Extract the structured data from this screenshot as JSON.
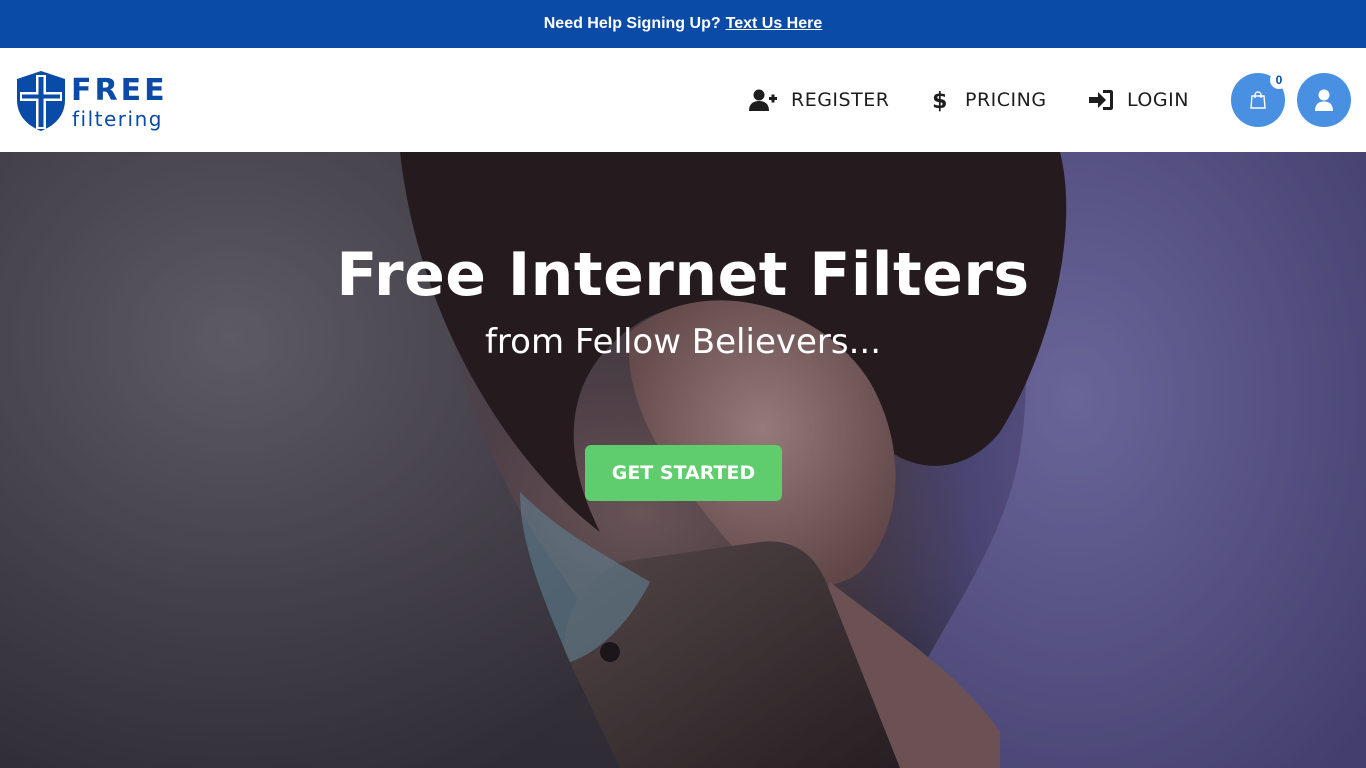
{
  "promo": {
    "text": "Need Help Signing Up?",
    "link": "Text Us Here"
  },
  "brand": {
    "name_top": "FREE",
    "name_bottom": "filtering",
    "color": "#0a4ba8"
  },
  "nav": {
    "register": "REGISTER",
    "pricing": "PRICING",
    "login": "LOGIN",
    "register_icon": "user-plus-icon",
    "pricing_icon": "dollar-icon",
    "login_icon": "sign-in-icon"
  },
  "cart": {
    "count": "0",
    "icon": "shopping-bag-icon"
  },
  "account": {
    "icon": "user-icon"
  },
  "hero": {
    "title": "Free Internet Filters",
    "subtitle": "from Fellow Believers...",
    "cta": "GET STARTED",
    "cta_color": "#5fcc6e",
    "image": "woman-using-phone-in-bed"
  }
}
